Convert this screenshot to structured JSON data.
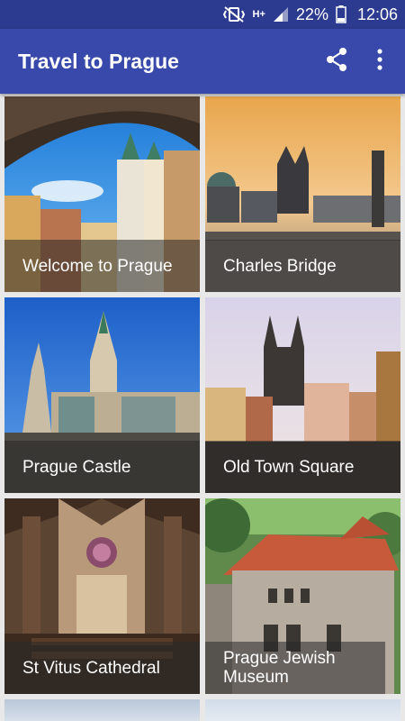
{
  "status_bar": {
    "network_type": "H+",
    "battery_percent": "22%",
    "time": "12:06"
  },
  "app_bar": {
    "title": "Travel to Prague",
    "share_icon": "share-icon",
    "overflow_icon": "more-vert-icon"
  },
  "tiles": [
    {
      "label": "Welcome to Prague"
    },
    {
      "label": "Charles Bridge"
    },
    {
      "label": "Prague Castle"
    },
    {
      "label": "Old Town Square"
    },
    {
      "label": "St Vitus Cathedral"
    },
    {
      "label": "Prague Jewish Museum"
    }
  ],
  "colors": {
    "status_bar": "#2c3a8f",
    "app_bar": "#3949ab",
    "background": "#e8e8e8"
  }
}
